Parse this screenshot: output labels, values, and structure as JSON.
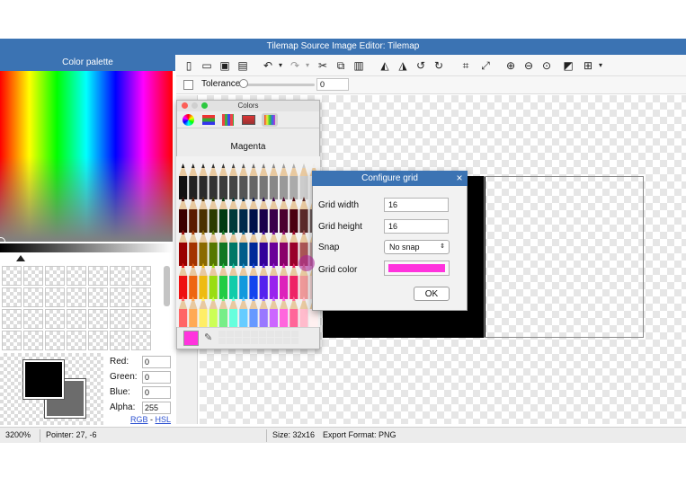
{
  "window": {
    "title": "Tilemap Source Image Editor: Tilemap"
  },
  "palette": {
    "header": "Color palette",
    "labels": {
      "red": "Red:",
      "green": "Green:",
      "blue": "Blue:",
      "alpha": "Alpha:"
    },
    "values": {
      "red": "0",
      "green": "0",
      "blue": "0",
      "alpha": "255"
    },
    "links": {
      "rgb": "RGB",
      "separator": " - ",
      "hsl": "HSL"
    },
    "foreground_color": "#000000",
    "background_color": "#6c6c6c"
  },
  "toolbar": {
    "icons": [
      "new-file-icon",
      "open-folder-icon",
      "save-icon",
      "save-as-icon",
      "undo-icon",
      "undo-dropdown-icon",
      "redo-icon",
      "redo-dropdown-icon",
      "cut-icon",
      "copy-icon",
      "paste-icon",
      "flip-horizontal-icon",
      "flip-vertical-icon",
      "rotate-left-icon",
      "rotate-right-icon",
      "crop-icon",
      "resize-icon",
      "zoom-in-icon",
      "zoom-out-icon",
      "zoom-fit-icon",
      "invert-icon",
      "grid-icon",
      "grid-dropdown-icon"
    ],
    "tolerance_label": "Tolerance",
    "tolerance_value": "0",
    "tolerance_level": 0
  },
  "colors_window": {
    "title": "Colors",
    "selected_color_name": "Magenta",
    "selected_color": "#ff33dd",
    "tabs": [
      "color-wheel-icon",
      "color-sliders-icon",
      "color-palettes-icon",
      "image-palettes-icon",
      "crayons-icon"
    ]
  },
  "grid_dialog": {
    "title": "Configure grid",
    "close": "×",
    "fields": {
      "grid_width_label": "Grid width",
      "grid_width_value": "16",
      "grid_height_label": "Grid height",
      "grid_height_value": "16",
      "snap_label": "Snap",
      "snap_value": "No snap",
      "grid_color_label": "Grid color",
      "grid_color_value": "#ff33dd"
    },
    "ok_label": "OK"
  },
  "status": {
    "zoom": "3200%",
    "pointer": "Pointer: 27, -6",
    "size": "Size: 32x16",
    "export_format": "Export Format: PNG"
  },
  "colors": {
    "title_bar": "#3b73b3",
    "accent": "#3b73b3",
    "magenta": "#ff33dd"
  }
}
